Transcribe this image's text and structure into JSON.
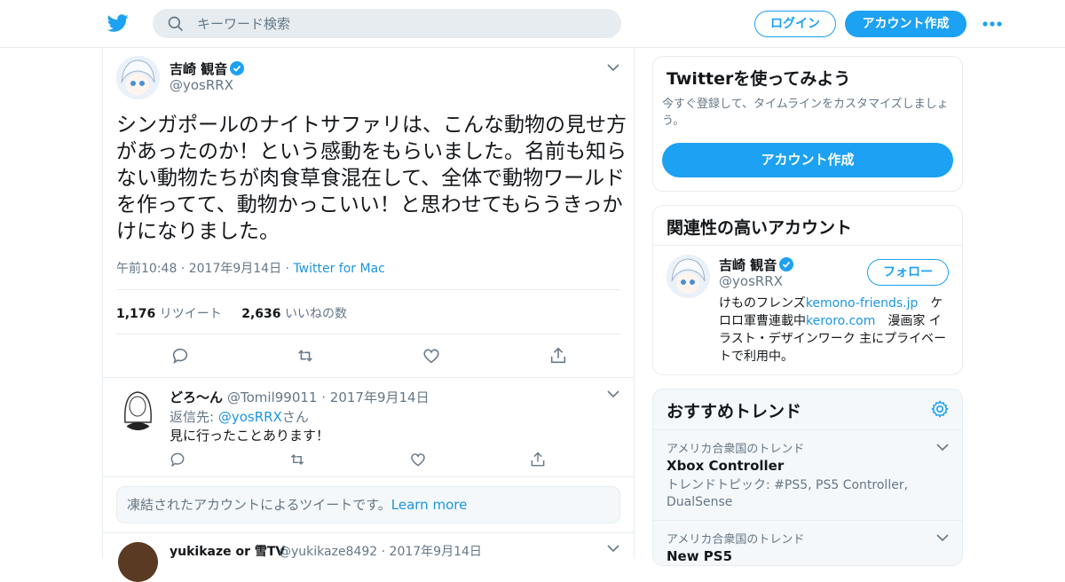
{
  "colors": {
    "accent": "#1da1f2",
    "link": "#1b95e0",
    "muted": "#657786",
    "border": "#e6ecf0"
  },
  "header": {
    "logo": "twitter-bird-icon",
    "search_placeholder": "キーワード検索",
    "login_label": "ログイン",
    "signup_label": "アカウント作成",
    "more_icon": "more-dots-icon"
  },
  "tweet": {
    "name": "吉崎 観音",
    "handle": "@yosRRX",
    "text": "シンガポールのナイトサファリは、こんな動物の見せ方があったのか！という感動をもらいました。名前も知らない動物たちが肉食草食混在して、全体で動物ワールドを作ってて、動物かっこいい！と思わせてもらうきっかけになりました。",
    "time": "午前10:48",
    "date": "2017年9月14日",
    "client": "Twitter for Mac",
    "retweet_count": "1,176",
    "retweet_label": "リツイート",
    "like_count": "2,636",
    "like_label": "いいねの数"
  },
  "reply": {
    "name": "どろ〜ん",
    "handle": "@Tomil99011",
    "date": "2017年9月14日",
    "reply_to_prefix": "返信先: ",
    "reply_to_handle": "@yosRRX",
    "reply_to_suffix": "さん",
    "text": "見に行ったことあります！"
  },
  "notice": {
    "text": "凍結されたアカウントによるツイートです。",
    "link": "Learn more"
  },
  "reply2": {
    "name": "yukikaze or 雪TV",
    "handle": "@yukikaze8492",
    "date": "2017年9月14日"
  },
  "signup_card": {
    "title": "Twitterを使ってみよう",
    "subtitle": "今すぐ登録して、タイムラインをカスタマイズしましょう。",
    "button": "アカウント作成"
  },
  "related_card": {
    "title": "関連性の高いアカウント",
    "name": "吉崎 観音",
    "handle": "@yosRRX",
    "follow": "フォロー",
    "bio_1": "けものフレンズ",
    "bio_link_1": "kemono-friends.jp",
    "bio_2": "　ケロロ軍曹連載中",
    "bio_link_2": "keroro.com",
    "bio_3": "　漫画家 イラスト・デザインワーク 主にプライベートで利用中。"
  },
  "trends_card": {
    "title": "おすすめトレンド",
    "items": [
      {
        "category": "アメリカ合衆国のトレンド",
        "name": "Xbox Controller",
        "desc": "トレンドトピック: #PS5, PS5 Controller, DualSense"
      },
      {
        "category": "アメリカ合衆国のトレンド",
        "name": "New PS5",
        "desc": ""
      }
    ]
  }
}
